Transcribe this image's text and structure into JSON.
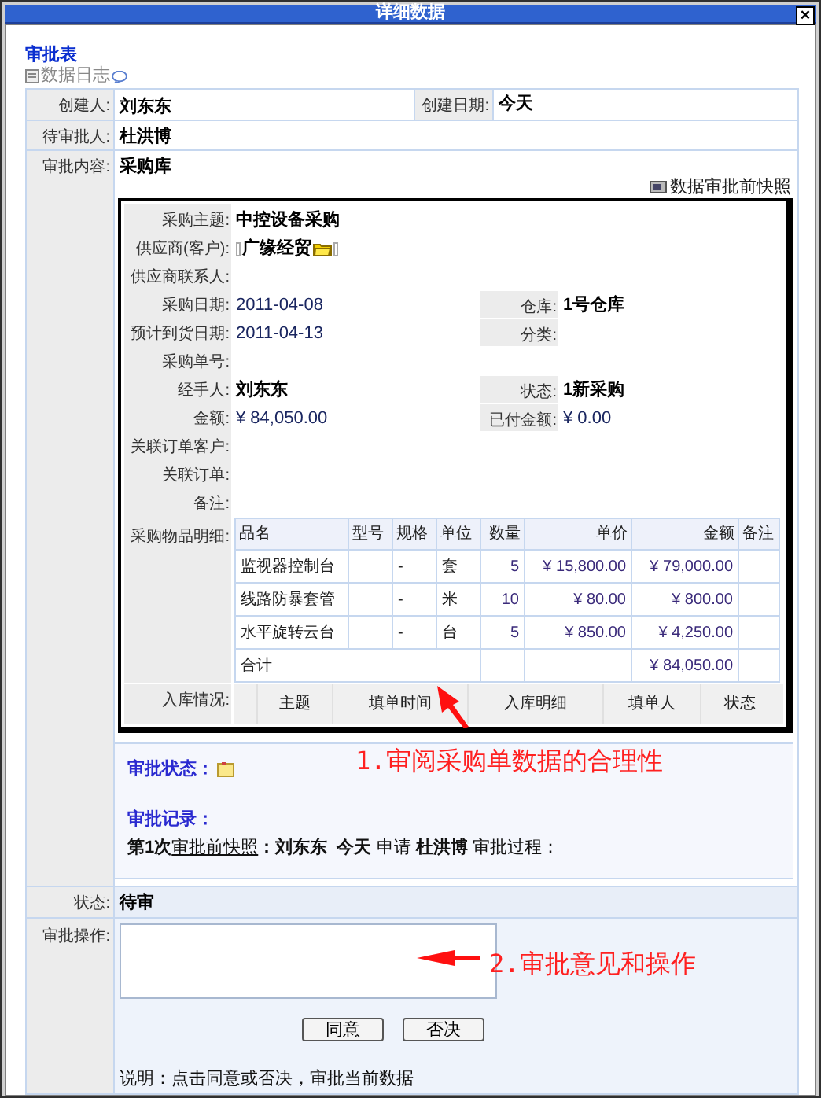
{
  "window": {
    "title": "详细数据",
    "close": "×"
  },
  "heading": "审批表",
  "log_link": "数据日志",
  "form": {
    "creator": {
      "label": "创建人:",
      "value": "刘东东"
    },
    "created_date": {
      "label": "创建日期:",
      "value": "今天"
    },
    "approver": {
      "label": "待审批人:",
      "value": "杜洪博"
    },
    "content": {
      "label": "审批内容:",
      "value": "采购库"
    }
  },
  "snapshot_link": "数据审批前快照",
  "order_fields": [
    {
      "cells": [
        {
          "label": "采购主题:",
          "value": "中控设备采购",
          "kind": "text"
        }
      ]
    },
    {
      "cells": [
        {
          "label": "供应商(客户):",
          "value": "广缘经贸",
          "kind": "supplier"
        }
      ]
    },
    {
      "cells": [
        {
          "label": "供应商联系人:"
        }
      ]
    },
    {
      "cells": [
        {
          "label": "采购日期:",
          "value": "2011-04-08",
          "kind": "number"
        },
        {
          "label": "仓库:",
          "value": "1号仓库",
          "kind": "text"
        }
      ]
    },
    {
      "cells": [
        {
          "label": "预计到货日期:",
          "value": "2011-04-13",
          "kind": "number"
        },
        {
          "label": "分类:"
        }
      ]
    },
    {
      "cells": [
        {
          "label": "采购单号:"
        }
      ]
    },
    {
      "cells": [
        {
          "label": "经手人:",
          "value": "刘东东",
          "kind": "text"
        },
        {
          "label": "状态:",
          "value": "1新采购",
          "kind": "text"
        }
      ]
    },
    {
      "cells": [
        {
          "label": "金额:",
          "value": "¥ 84,050.00",
          "kind": "number"
        },
        {
          "label": "已付金额:",
          "value": "¥ 0.00",
          "kind": "number"
        }
      ]
    },
    {
      "cells": [
        {
          "label": "关联订单客户:"
        }
      ]
    },
    {
      "cells": [
        {
          "label": "关联订单:"
        }
      ]
    },
    {
      "cells": [
        {
          "label": "备注:"
        }
      ]
    }
  ],
  "items": {
    "label": "采购物品明细:",
    "columns": [
      "品名",
      "型号",
      "规格",
      "单位",
      "数量",
      "单价",
      "金额",
      "备注"
    ],
    "rows": [
      {
        "name": "监视器控制台",
        "spec": "-",
        "unit": "套",
        "qty": "5",
        "price": "¥ 15,800.00",
        "amount": "¥ 79,000.00"
      },
      {
        "name": "线路防暴套管",
        "spec": "-",
        "unit": "米",
        "qty": "10",
        "price": "¥ 80.00",
        "amount": "¥ 800.00"
      },
      {
        "name": "水平旋转云台",
        "spec": "-",
        "unit": "台",
        "qty": "5",
        "price": "¥ 850.00",
        "amount": "¥ 4,250.00"
      }
    ],
    "total": {
      "label": "合计",
      "amount": "¥ 84,050.00"
    }
  },
  "inbound": {
    "label": "入库情况:",
    "columns": [
      "主题",
      "填单时间",
      "入库明细",
      "填单人",
      "状态"
    ]
  },
  "approval": {
    "status_label": "审批状态：",
    "records_label": "审批记录：",
    "record": {
      "prefix": "**第1次**",
      "link": "审批前快照",
      "rest": "**：刘东东  今天** 申请 **杜洪博** 审批过程："
    }
  },
  "status": {
    "label": "状态:",
    "value": "待审"
  },
  "operation": {
    "label": "审批操作:",
    "buttons": [
      "同意",
      "否决"
    ],
    "note": "说明：点击同意或否决，审批当前数据"
  },
  "annotations": [
    {
      "text": "1.审阅采购单数据的合理性"
    },
    {
      "text": "2.审批意见和操作"
    }
  ]
}
